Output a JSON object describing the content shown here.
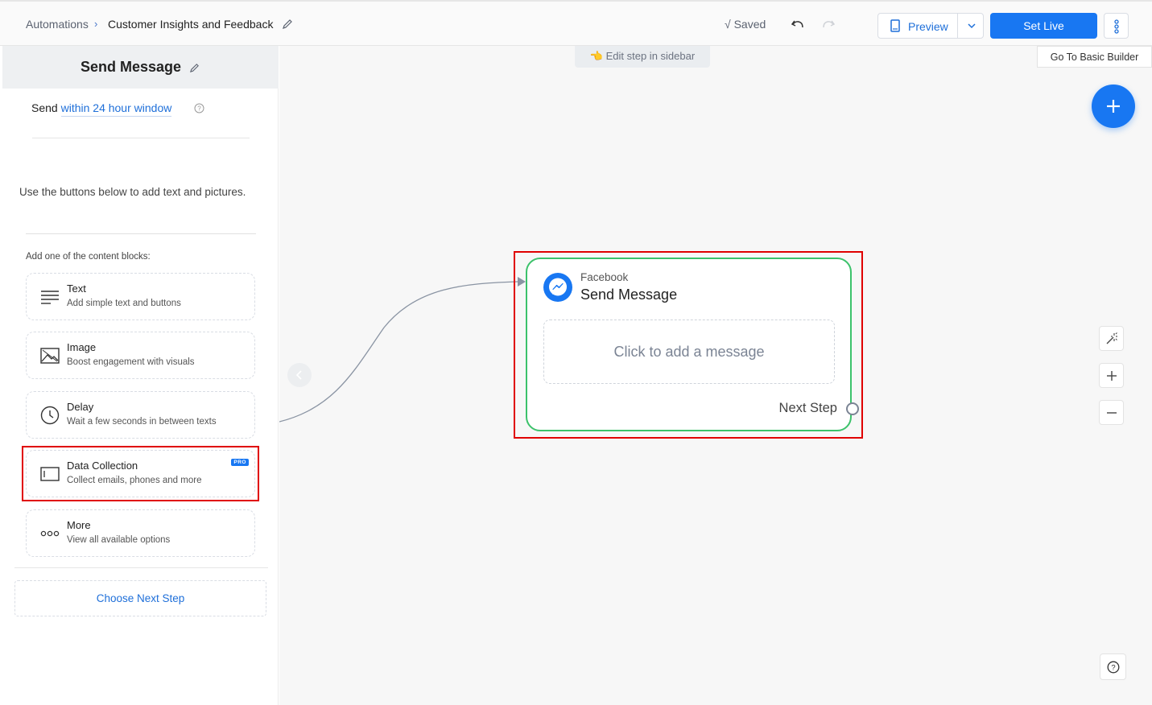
{
  "topbar": {
    "breadcrumb_root": "Automations",
    "breadcrumb_separator": "›",
    "breadcrumb_current": "Customer Insights and Feedback",
    "saved_status": "√ Saved",
    "preview_label": "Preview",
    "set_live_label": "Set Live"
  },
  "sidebar": {
    "title": "Send Message",
    "send_prefix": "Send",
    "send_window": "within 24 hour window",
    "hint": "Use the buttons below to add text and pictures.",
    "blocks_label": "Add one of the content blocks:",
    "blocks": [
      {
        "title": "Text",
        "subtitle": "Add simple text and buttons",
        "icon": "text-lines-icon"
      },
      {
        "title": "Image",
        "subtitle": "Boost engagement with visuals",
        "icon": "image-icon"
      },
      {
        "title": "Delay",
        "subtitle": "Wait a few seconds in between texts",
        "icon": "clock-icon"
      },
      {
        "title": "Data Collection",
        "subtitle": "Collect emails, phones and more",
        "icon": "input-field-icon",
        "badge": "PRO"
      },
      {
        "title": "More",
        "subtitle": "View all available options",
        "icon": "more-dots-icon"
      }
    ],
    "choose_next_step": "Choose Next Step"
  },
  "canvas": {
    "edit_hint": "Edit step in sidebar",
    "basic_builder": "Go To Basic Builder",
    "node": {
      "platform": "Facebook",
      "title": "Send Message",
      "placeholder": "Click to add a message",
      "next_step": "Next Step"
    }
  },
  "colors": {
    "accent": "#1877f2",
    "node_border": "#3cc26b",
    "highlight": "#e00000"
  }
}
